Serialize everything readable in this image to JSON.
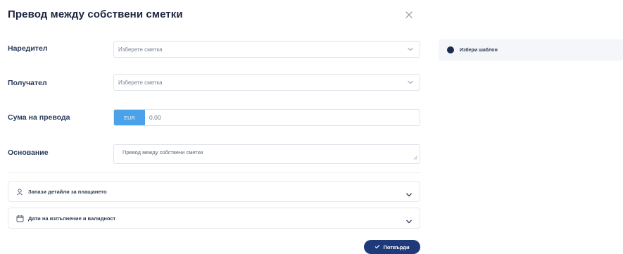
{
  "dialog": {
    "title": "Превод между собствени сметки"
  },
  "form": {
    "payer": {
      "label": "Наредител",
      "placeholder": "Изберете сметка"
    },
    "recipient": {
      "label": "Получател",
      "placeholder": "Изберете сметка"
    },
    "amount": {
      "label": "Сума на превода",
      "currency": "EUR",
      "value": "0,00"
    },
    "reason": {
      "label": "Основание",
      "value": "Превод между собствени сметки"
    }
  },
  "sections": {
    "payment_details": "Запази детайли за плащането",
    "execution_dates": "Дати на изпълнение и валидност"
  },
  "actions": {
    "confirm_label": "Потвърди"
  },
  "side": {
    "template_label": "Избери шаблон"
  },
  "colors": {
    "accent": "#4aa3ea",
    "primary": "#1e3a7a",
    "text": "#1b2440"
  }
}
